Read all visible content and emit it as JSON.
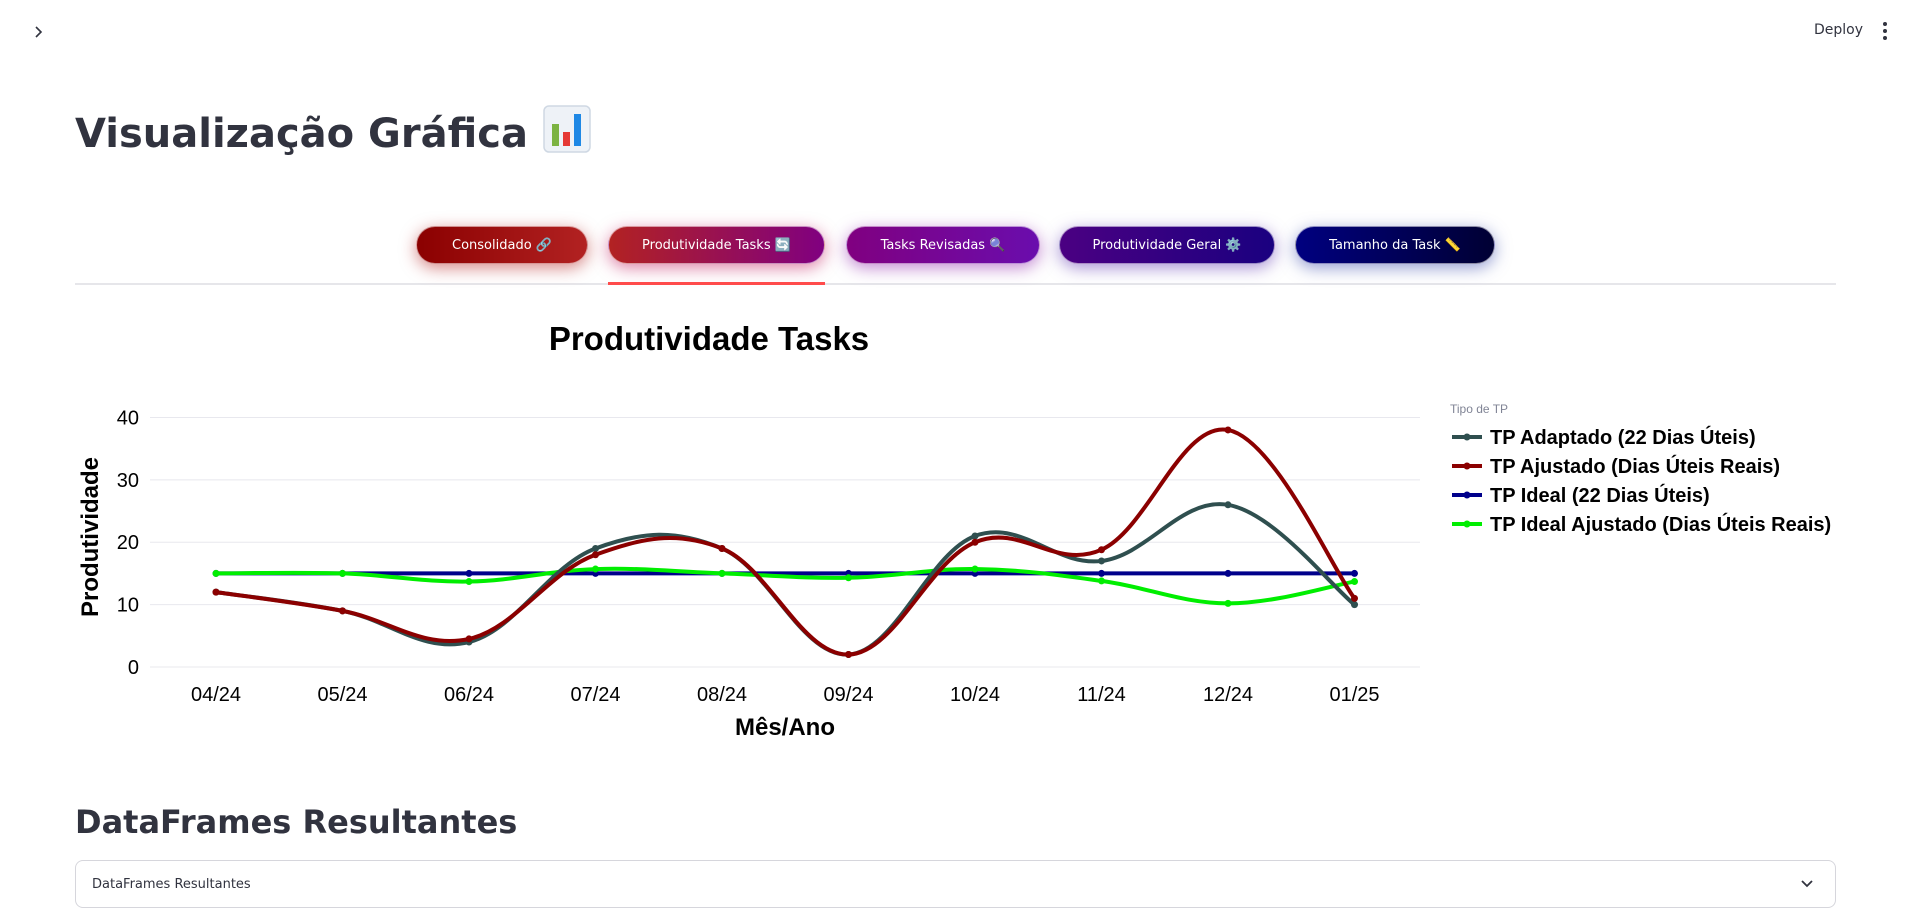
{
  "header": {
    "deploy_label": "Deploy",
    "sidebar_toggle_icon": "chevron-right-icon",
    "menu_icon": "kebab-menu-icon"
  },
  "page": {
    "title": "Visualização Gráfica",
    "title_icon": "bar-chart-icon"
  },
  "tabs": [
    {
      "label": "Consolidado 🔗",
      "selected": false,
      "gradient": [
        "#8b0000",
        "#b22222"
      ],
      "glow": "#b22222"
    },
    {
      "label": "Produtividade Tasks 🔄",
      "selected": true,
      "gradient": [
        "#b22222",
        "#800080"
      ],
      "glow": "#c2185b"
    },
    {
      "label": "Tasks Revisadas 🔍",
      "selected": false,
      "gradient": [
        "#800080",
        "#6a0dad"
      ],
      "glow": "#8e24aa"
    },
    {
      "label": "Produtividade Geral ⚙️",
      "selected": false,
      "gradient": [
        "#4b0082",
        "#1a0080"
      ],
      "glow": "#5e35b1"
    },
    {
      "label": "Tamanho da Task 📏",
      "selected": false,
      "gradient": [
        "#000080",
        "#000033"
      ],
      "glow": "#3949ab"
    }
  ],
  "chart_data": {
    "type": "line",
    "title": "Produtividade Tasks",
    "xlabel": "Mês/Ano",
    "ylabel": "Produtividade",
    "categories": [
      "04/24",
      "05/24",
      "06/24",
      "07/24",
      "08/24",
      "09/24",
      "10/24",
      "11/24",
      "12/24",
      "01/25"
    ],
    "ylim": [
      0,
      42
    ],
    "yticks": [
      0,
      10,
      20,
      30,
      40
    ],
    "grid": true,
    "legend_title": "Tipo de TP",
    "legend_position": "right",
    "series": [
      {
        "name": "TP Adaptado (22 Dias Úteis)",
        "color": "#2f4f4f",
        "values": [
          12,
          9,
          4,
          19,
          19,
          2,
          21,
          17,
          26,
          10
        ]
      },
      {
        "name": "TP Ajustado (Dias Úteis Reais)",
        "color": "#8b0000",
        "values": [
          12,
          9,
          4.5,
          18,
          19,
          2,
          20,
          18.8,
          38,
          11
        ]
      },
      {
        "name": "TP Ideal (22 Dias Úteis)",
        "color": "#00008b",
        "values": [
          15,
          15,
          15,
          15,
          15,
          15,
          15,
          15,
          15,
          15
        ]
      },
      {
        "name": "TP Ideal Ajustado (Dias Úteis Reais)",
        "color": "#00ee00",
        "values": [
          15,
          15,
          13.7,
          15.7,
          15,
          14.3,
          15.7,
          13.8,
          10.2,
          13.7
        ]
      }
    ]
  },
  "section": {
    "title": "DataFrames Resultantes",
    "expander_label": "DataFrames Resultantes",
    "expander_icon": "chevron-down-icon"
  }
}
